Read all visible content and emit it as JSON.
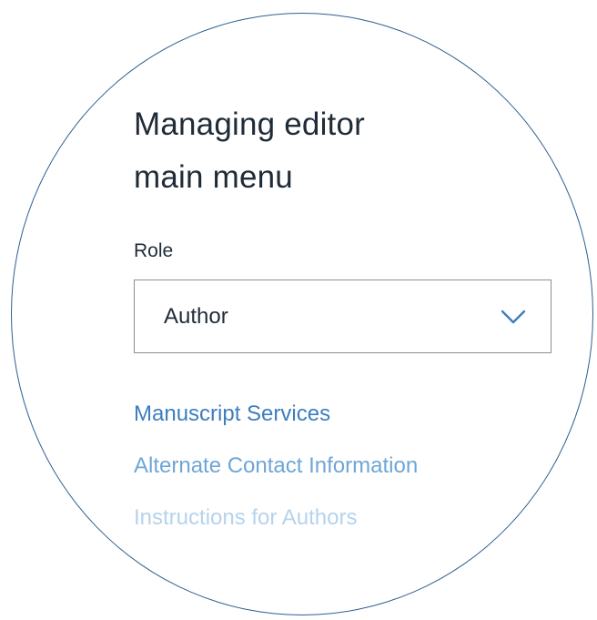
{
  "header": {
    "title_line1": "Managing editor",
    "title_line2": "main menu"
  },
  "role": {
    "label": "Role",
    "selected": "Author",
    "icon": "chevron-down-icon"
  },
  "links": [
    {
      "label": "Manuscript Services"
    },
    {
      "label": "Alternate Contact Information"
    },
    {
      "label": "Instructions for Authors"
    }
  ],
  "colors": {
    "circle_border": "#2f5f8f",
    "link_primary": "#3d7ebf",
    "chevron": "#3d7ebf",
    "text": "#1f2b36"
  }
}
